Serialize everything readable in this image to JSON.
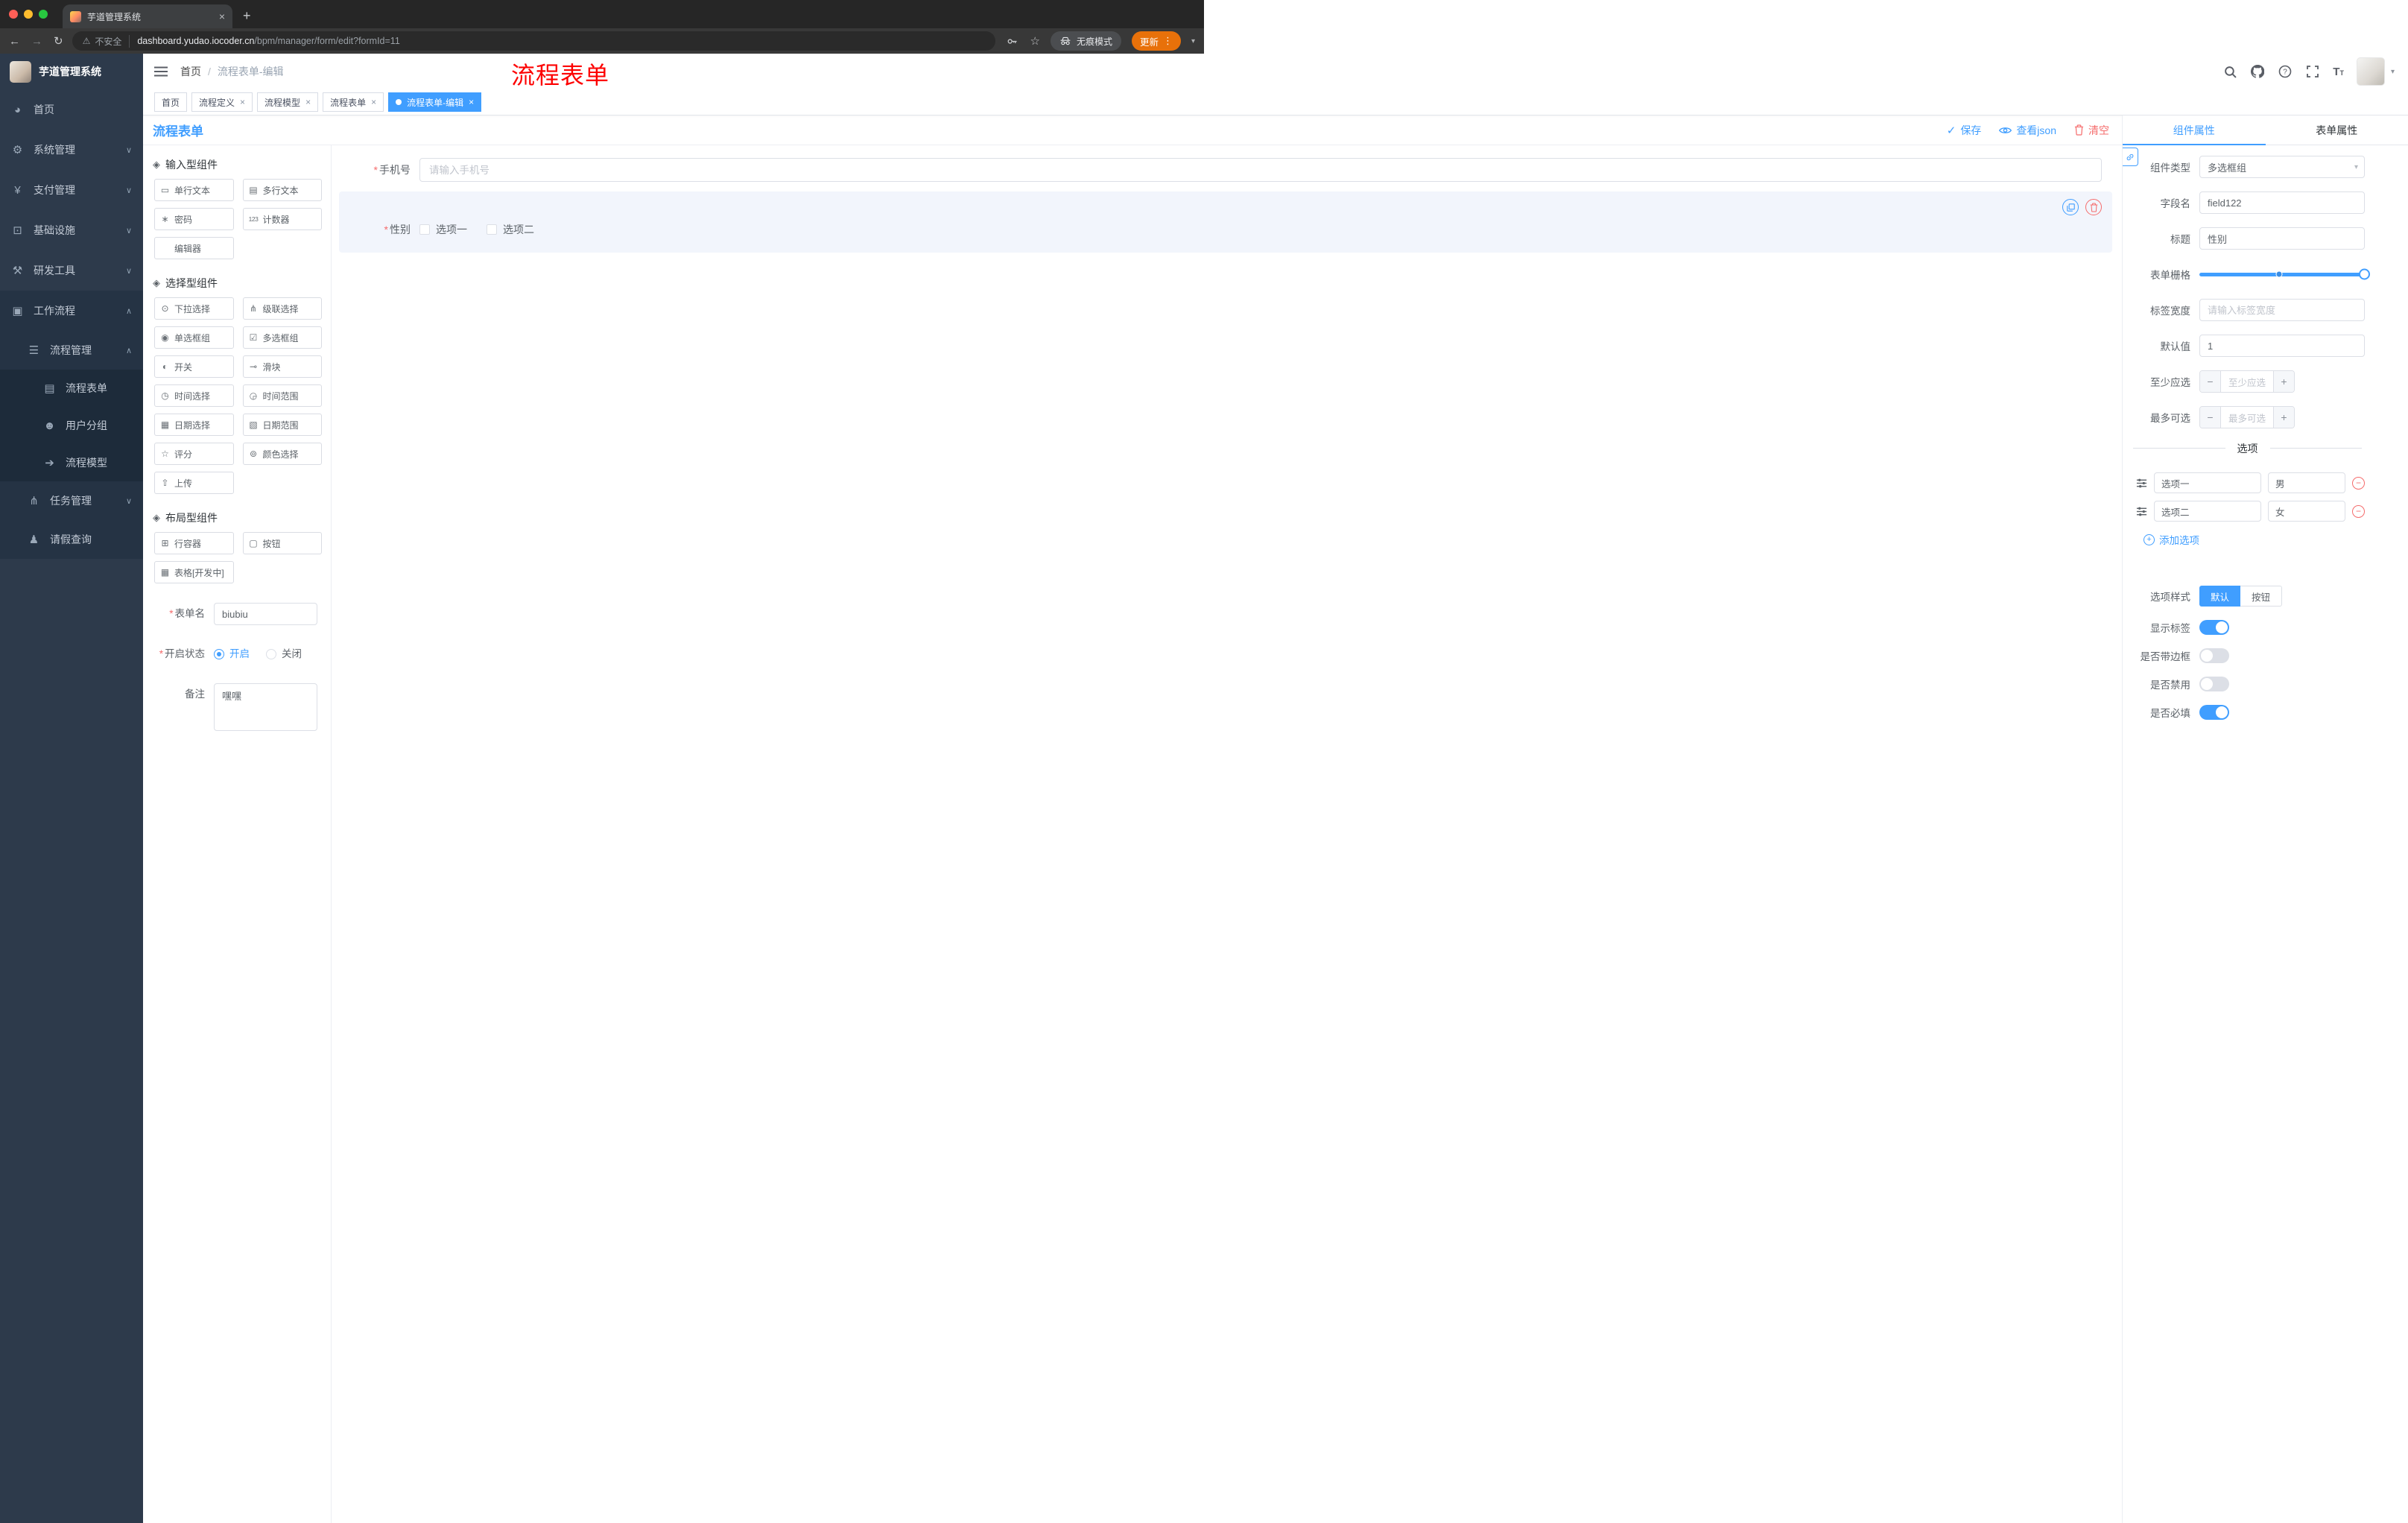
{
  "browser": {
    "tab_title": "芋道管理系统",
    "close": "×",
    "new_tab": "+",
    "back": "←",
    "forward": "→",
    "reload": "↻",
    "warning": "⚠",
    "security_label": "不安全",
    "url_host": "dashboard.yudao.iocoder.cn",
    "url_path": "/bpm/manager/form/edit?formId=11",
    "star": "☆",
    "incognito_label": "无痕模式",
    "update_label": "更新",
    "menu_dots": "⋮",
    "caret": "▾"
  },
  "sidebar": {
    "logo_title": "芋道管理系统",
    "items": [
      {
        "glyph": "◕",
        "label": "首页"
      },
      {
        "glyph": "⚙",
        "label": "系统管理",
        "chevron": "∨"
      },
      {
        "glyph": "¥",
        "label": "支付管理",
        "chevron": "∨"
      },
      {
        "glyph": "⊡",
        "label": "基础设施",
        "chevron": "∨"
      },
      {
        "glyph": "⚒",
        "label": "研发工具",
        "chevron": "∨"
      },
      {
        "glyph": "▣",
        "label": "工作流程",
        "chevron": "∧"
      },
      {
        "glyph": "☰",
        "label": "流程管理",
        "chevron": "∧"
      },
      {
        "glyph": "▤",
        "label": "流程表单"
      },
      {
        "glyph": "☻",
        "label": "用户分组"
      },
      {
        "glyph": "➔",
        "label": "流程模型"
      },
      {
        "glyph": "⋔",
        "label": "任务管理",
        "chevron": "∨"
      },
      {
        "glyph": "♟",
        "label": "请假查询"
      }
    ]
  },
  "header": {
    "breadcrumb_home": "首页",
    "breadcrumb_sep": "/",
    "breadcrumb_current": "流程表单-编辑",
    "annotation": "流程表单"
  },
  "tags": [
    {
      "label": "首页"
    },
    {
      "label": "流程定义",
      "close": "×"
    },
    {
      "label": "流程模型",
      "close": "×"
    },
    {
      "label": "流程表单",
      "close": "×"
    },
    {
      "label": "流程表单-编辑",
      "close": "×"
    }
  ],
  "designer": {
    "title": "流程表单",
    "save": "保存",
    "save_check": "✓",
    "view_json": "查看json",
    "clear": "清空"
  },
  "components": {
    "groups": [
      {
        "icon": "◈",
        "title": "输入型组件",
        "items": [
          {
            "glyph": "▭",
            "label": "单行文本"
          },
          {
            "glyph": "▤",
            "label": "多行文本"
          },
          {
            "glyph": "∗",
            "label": "密码"
          },
          {
            "glyph": "123",
            "label": "计数器"
          },
          {
            "glyph": "",
            "label": "编辑器"
          }
        ]
      },
      {
        "icon": "◈",
        "title": "选择型组件",
        "items": [
          {
            "glyph": "⊙",
            "label": "下拉选择"
          },
          {
            "glyph": "⋔",
            "label": "级联选择"
          },
          {
            "glyph": "◉",
            "label": "单选框组"
          },
          {
            "glyph": "☑",
            "label": "多选框组"
          },
          {
            "glyph": "◐",
            "label": "开关"
          },
          {
            "glyph": "⊸",
            "label": "滑块"
          },
          {
            "glyph": "◷",
            "label": "时间选择"
          },
          {
            "glyph": "◶",
            "label": "时间范围"
          },
          {
            "glyph": "▦",
            "label": "日期选择"
          },
          {
            "glyph": "▧",
            "label": "日期范围"
          },
          {
            "glyph": "☆",
            "label": "评分"
          },
          {
            "glyph": "⊚",
            "label": "颜色选择"
          },
          {
            "glyph": "⇧",
            "label": "上传"
          }
        ]
      },
      {
        "icon": "◈",
        "title": "布局型组件",
        "items": [
          {
            "glyph": "⊞",
            "label": "行容器"
          },
          {
            "glyph": "▢",
            "label": "按钮"
          },
          {
            "glyph": "▦",
            "label": "表格[开发中]"
          }
        ]
      }
    ],
    "meta": {
      "name_label": "表单名",
      "name_value": "biubiu",
      "status_label": "开启状态",
      "status_on": "开启",
      "status_off": "关闭",
      "remark_label": "备注",
      "remark_value": "嘿嘿"
    }
  },
  "canvas": {
    "phone_label": "手机号",
    "phone_placeholder": "请输入手机号",
    "gender_label": "性别",
    "gender_opt1": "选项一",
    "gender_opt2": "选项二"
  },
  "props": {
    "tab_component": "组件属性",
    "tab_form": "表单属性",
    "rows": {
      "type_label": "组件类型",
      "type_value": "多选框组",
      "field_label": "字段名",
      "field_value": "field122",
      "title_label": "标题",
      "title_value": "性别",
      "grid_label": "表单栅格",
      "width_label": "标签宽度",
      "width_placeholder": "请输入标签宽度",
      "default_label": "默认值",
      "default_value": "1",
      "min_label": "至少应选",
      "min_placeholder": "至少应选",
      "max_label": "最多可选",
      "max_placeholder": "最多可选"
    },
    "options_divider": "选项",
    "options": [
      {
        "label": "选项一",
        "value": "男"
      },
      {
        "label": "选项二",
        "value": "女"
      }
    ],
    "add_option": "添加选项",
    "style_label": "选项样式",
    "style_default": "默认",
    "style_button": "按钮",
    "show_label": "显示标签",
    "border_label": "是否带边框",
    "disabled_label": "是否禁用",
    "required_label": "是否必填"
  }
}
